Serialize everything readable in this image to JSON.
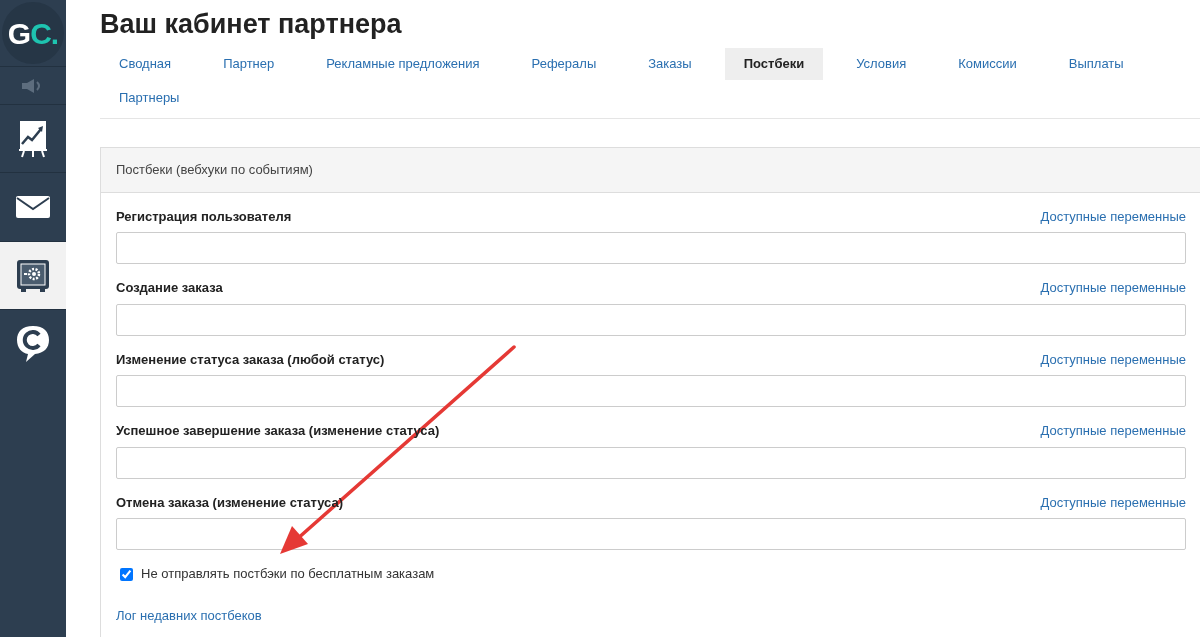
{
  "sidebar": {
    "logo": {
      "part1": "G",
      "part2": "C."
    },
    "items": [
      {
        "kind": "sound",
        "selected": false
      },
      {
        "kind": "chart",
        "selected": false
      },
      {
        "kind": "mail",
        "selected": false
      },
      {
        "kind": "safe",
        "selected": true
      },
      {
        "kind": "chat",
        "selected": false
      }
    ]
  },
  "title": "Ваш кабинет партнера",
  "tabs": [
    {
      "label": "Сводная",
      "selected": false
    },
    {
      "label": "Партнер",
      "selected": false
    },
    {
      "label": "Рекламные предложения",
      "selected": false
    },
    {
      "label": "Рефералы",
      "selected": false
    },
    {
      "label": "Заказы",
      "selected": false
    },
    {
      "label": "Постбеки",
      "selected": true
    },
    {
      "label": "Условия",
      "selected": false
    },
    {
      "label": "Комиссии",
      "selected": false
    },
    {
      "label": "Выплаты",
      "selected": false
    },
    {
      "label": "Партнеры",
      "selected": false
    }
  ],
  "card": {
    "header": "Постбеки (вебхуки по событиям)",
    "fields": [
      {
        "label": "Регистрация пользователя",
        "link": "Доступные переменные"
      },
      {
        "label": "Создание заказа",
        "link": "Доступные переменные"
      },
      {
        "label": "Изменение статуса заказа (любой статус)",
        "link": "Доступные переменные"
      },
      {
        "label": "Успешное завершение заказа (изменение статуса)",
        "link": "Доступные переменные"
      },
      {
        "label": "Отмена заказа (изменение статуса)",
        "link": "Доступные переменные"
      }
    ],
    "checkbox": {
      "label": "Не отправлять постбэки по бесплатным заказам",
      "checked": true
    },
    "log_link": "Лог недавних постбеков"
  }
}
